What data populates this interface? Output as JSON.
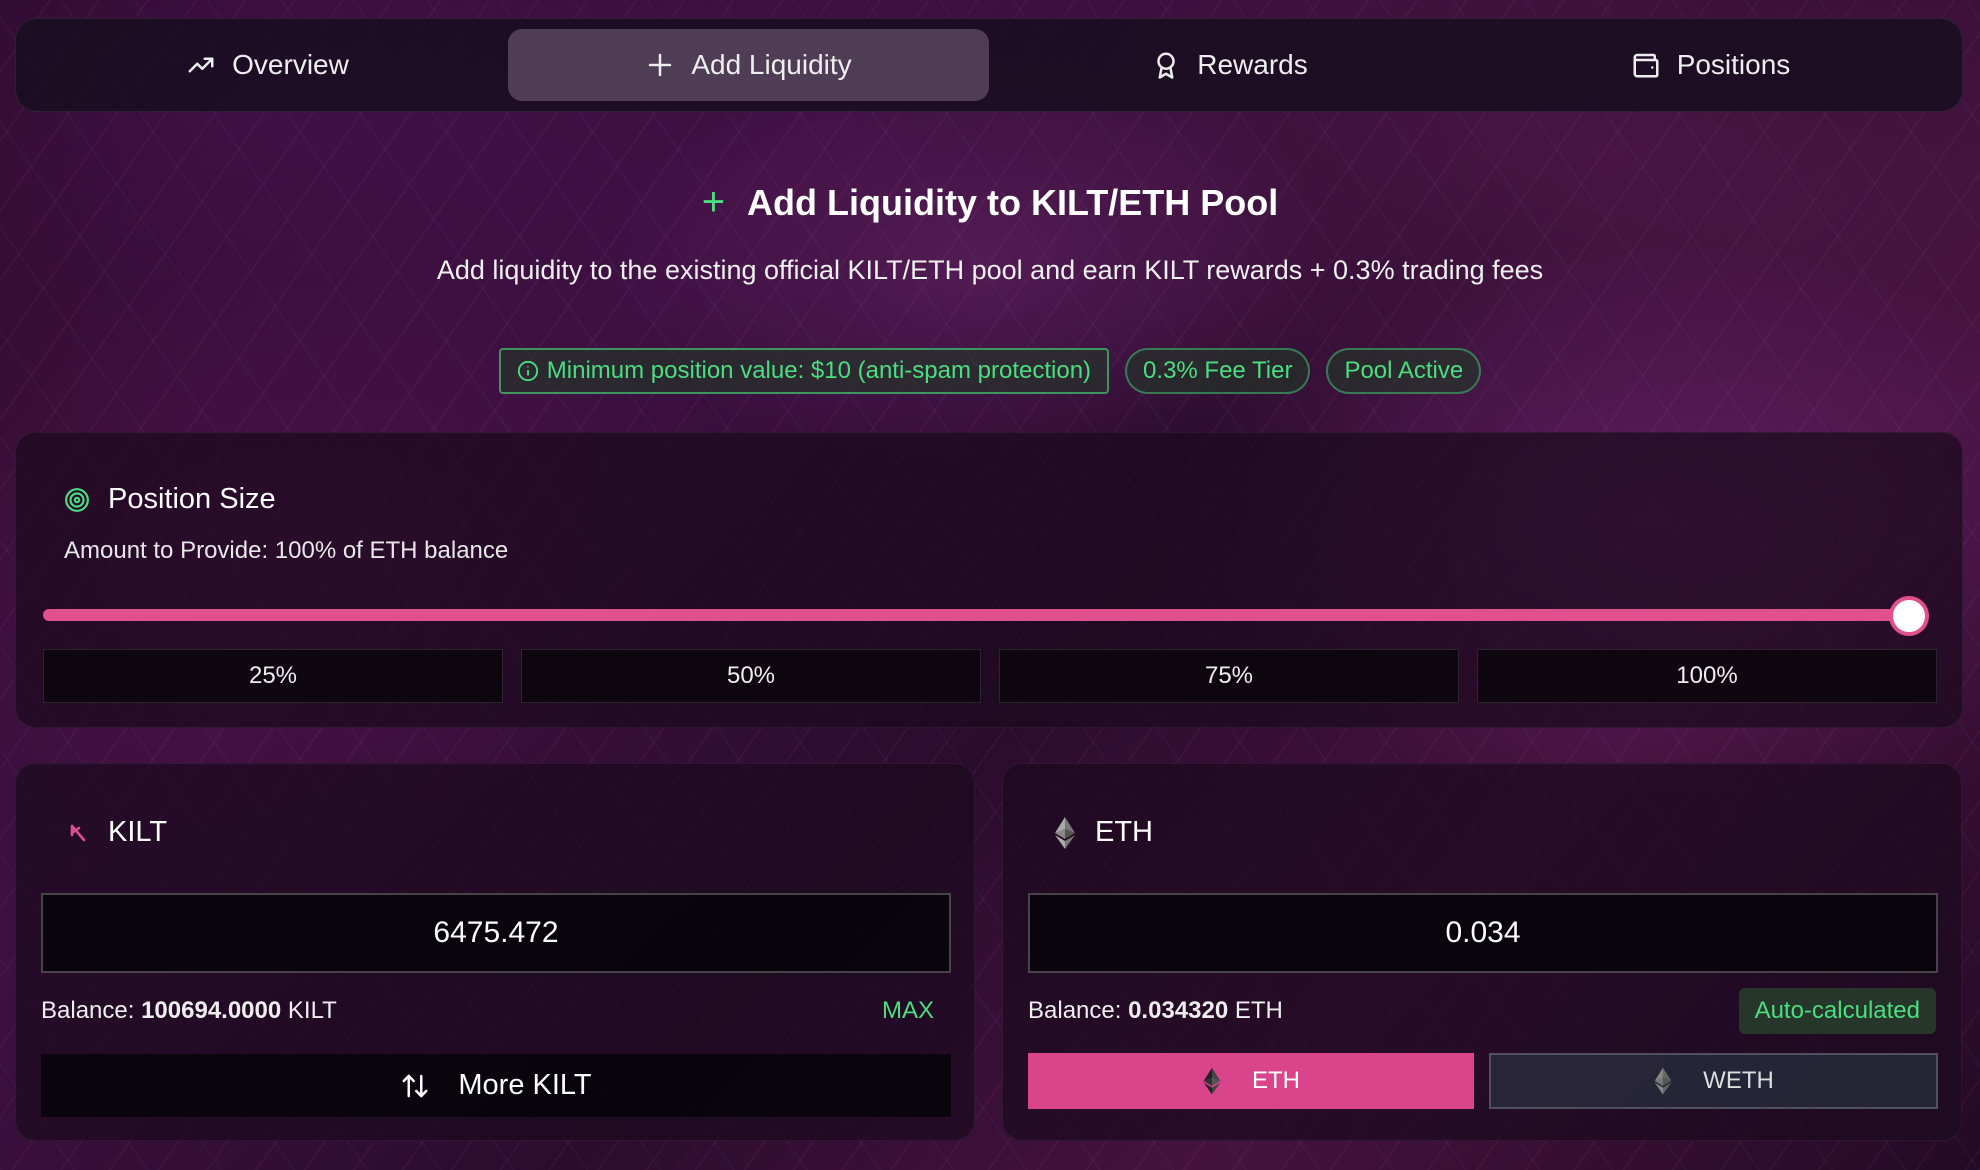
{
  "nav": {
    "tabs": [
      {
        "label": "Overview",
        "icon": "trending-up-icon"
      },
      {
        "label": "Add Liquidity",
        "icon": "plus-icon",
        "active": true
      },
      {
        "label": "Rewards",
        "icon": "award-icon"
      },
      {
        "label": "Positions",
        "icon": "wallet-icon"
      }
    ]
  },
  "header": {
    "title": "Add Liquidity to KILT/ETH Pool",
    "subtitle": "Add liquidity to the existing official KILT/ETH pool and earn KILT rewards + 0.3% trading fees",
    "badges": {
      "min_value": "Minimum position value: $10 (anti-spam protection)",
      "fee_tier": "0.3% Fee Tier",
      "pool_status": "Pool Active"
    }
  },
  "position": {
    "title": "Position Size",
    "subtitle": "Amount to Provide: 100% of ETH balance",
    "slider_percent": 100,
    "presets": [
      "25%",
      "50%",
      "75%",
      "100%"
    ]
  },
  "kilt": {
    "token": "KILT",
    "amount": "6475.472",
    "balance_label": "Balance:",
    "balance_value": "100694.0000",
    "balance_unit": "KILT",
    "max_label": "MAX",
    "more_label": "More KILT"
  },
  "eth": {
    "token": "ETH",
    "amount": "0.034",
    "balance_label": "Balance:",
    "balance_value": "0.034320",
    "balance_unit": "ETH",
    "auto_label": "Auto-calculated",
    "options": [
      "ETH",
      "WETH"
    ],
    "selected": "ETH"
  },
  "colors": {
    "accent_pink": "#e0508d",
    "success_green": "#4ade80"
  }
}
